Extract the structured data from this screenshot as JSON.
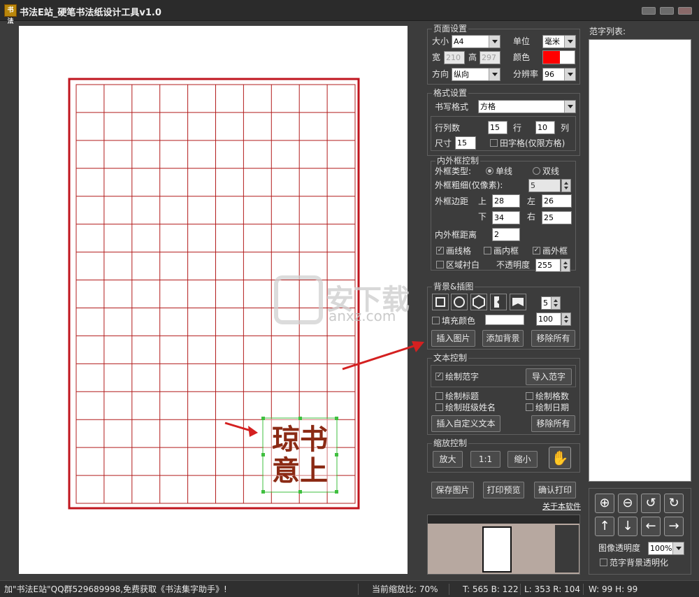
{
  "window": {
    "title": "书法E站_硬笔书法纸设计工具v1.0",
    "icon_text": "书法"
  },
  "page_settings": {
    "title": "页面设置",
    "size_label": "大小",
    "size_value": "A4",
    "unit_label": "单位",
    "unit_value": "毫米",
    "width_label": "宽",
    "width_value": "210",
    "height_label": "高",
    "height_value": "297",
    "color_label": "颜色",
    "color_value": "#ff0000",
    "orientation_label": "方向",
    "orientation_value": "纵向",
    "resolution_label": "分辨率",
    "resolution_value": "96"
  },
  "format_settings": {
    "title": "格式设置",
    "style_label": "书写格式",
    "style_value": "方格",
    "rows_cols_label": "行列数",
    "rows_value": "15",
    "rows_unit": "行",
    "cols_value": "10",
    "cols_unit": "列",
    "size_label": "尺寸",
    "size_value": "15",
    "tianzige_label": "田字格(仅限方格)"
  },
  "frame_control": {
    "title": "内外框控制",
    "type_label": "外框类型:",
    "single_label": "单线",
    "double_label": "双线",
    "thickness_label": "外框粗细(仅像素):",
    "thickness_value": "5",
    "margin_label": "外框边距",
    "top_label": "上",
    "top_value": "28",
    "left_label": "左",
    "left_value": "26",
    "bottom_label": "下",
    "bottom_value": "34",
    "right_label": "右",
    "right_value": "25",
    "inner_outer_label": "内外框距离",
    "inner_outer_value": "2",
    "draw_grid_label": "画线格",
    "draw_inner_label": "画内框",
    "draw_outer_label": "画外框",
    "area_bg_label": "区域衬白",
    "opacity_label": "不透明度",
    "opacity_value": "255"
  },
  "background": {
    "title": "背景&插图",
    "shape_count": "5",
    "fill_label": "填充颜色",
    "fill_color": "#ffffff",
    "fill_value": "100",
    "insert_image": "插入图片",
    "add_background": "添加背景",
    "remove_all": "移除所有"
  },
  "text_control": {
    "title": "文本控制",
    "draw_sample_label": "绘制范字",
    "import_sample": "导入范字",
    "draw_title": "绘制标题",
    "draw_grid_count": "绘制格数",
    "draw_class_name": "绘制班级姓名",
    "draw_date": "绘制日期",
    "insert_custom_text": "插入自定义文本",
    "remove_all": "移除所有"
  },
  "zoom_control": {
    "title": "缩放控制",
    "zoom_in": "放大",
    "actual_size": "1:1",
    "zoom_out": "缩小"
  },
  "actions": {
    "save_image": "保存图片",
    "print_preview": "打印预览",
    "confirm_print": "确认打印",
    "about": "关于本软件"
  },
  "sample_list": {
    "title": "范字列表:",
    "image_opacity_label": "图像透明度",
    "image_opacity_value": "100%",
    "bg_transparent_label": "范字背景透明化"
  },
  "seal_text": "琼书意上",
  "watermark": {
    "text": "安下载",
    "subtext": "anxz.com"
  },
  "status": {
    "promo": "加\"书法E站\"QQ群529689998,免费获取《书法集字助手》!",
    "zoom": "当前缩放比: 70%",
    "tb": "T: 565 B: 122",
    "lr": "L: 353 R: 104",
    "wh": "W: 99 H: 99"
  },
  "colors": {
    "grid": "#b21c1c",
    "frame": "#c0151e",
    "seal": "#8b2a14",
    "selection": "#3fbf3f"
  }
}
